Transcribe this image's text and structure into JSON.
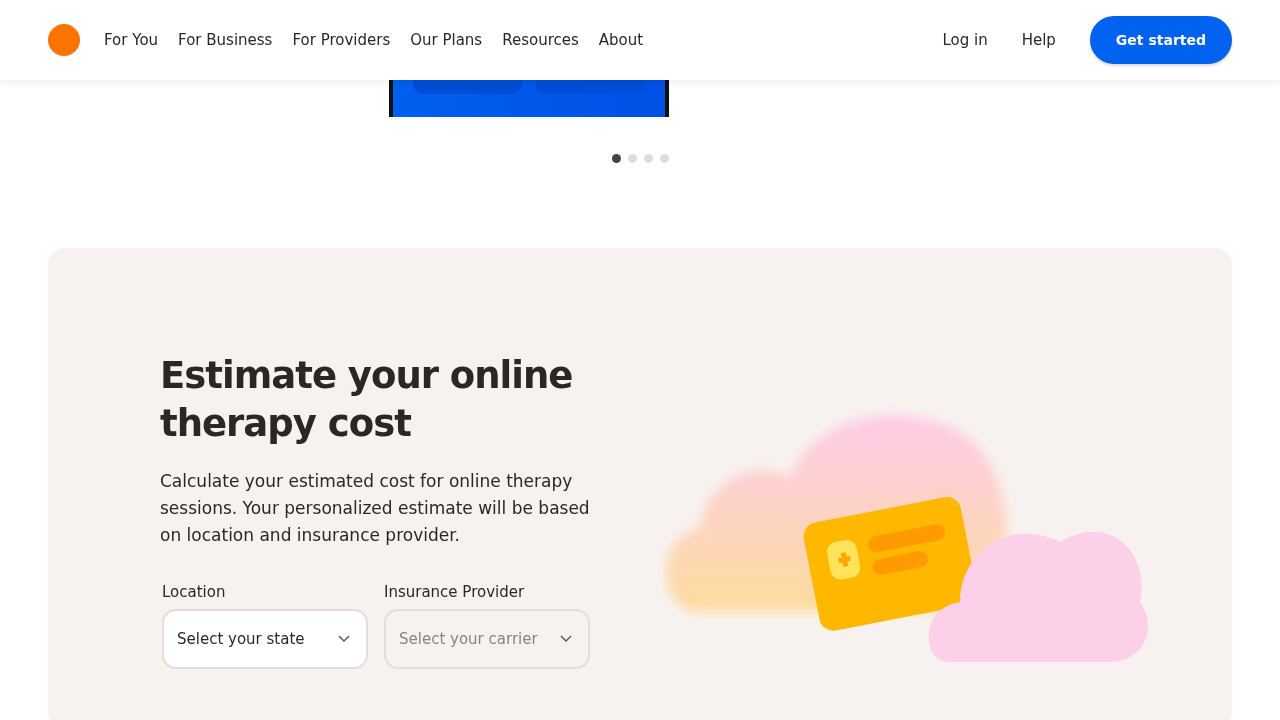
{
  "header": {
    "nav": [
      {
        "label": "For You"
      },
      {
        "label": "For Business"
      },
      {
        "label": "For Providers"
      },
      {
        "label": "Our Plans"
      },
      {
        "label": "Resources"
      },
      {
        "label": "About"
      }
    ],
    "login": "Log in",
    "help": "Help",
    "cta": "Get started"
  },
  "carousel": {
    "dots": [
      {
        "selected": true
      },
      {
        "selected": false
      },
      {
        "selected": false
      },
      {
        "selected": false
      }
    ]
  },
  "estimate": {
    "title": "Estimate your online therapy cost",
    "description": "Calculate your estimated cost for online therapy sessions. Your personalized estimate will be based on location and insurance provider.",
    "fields": [
      {
        "label": "Location",
        "placeholder": "Select your state",
        "disabled": false
      },
      {
        "label": "Insurance Provider",
        "placeholder": "Select your carrier",
        "disabled": true
      }
    ]
  }
}
